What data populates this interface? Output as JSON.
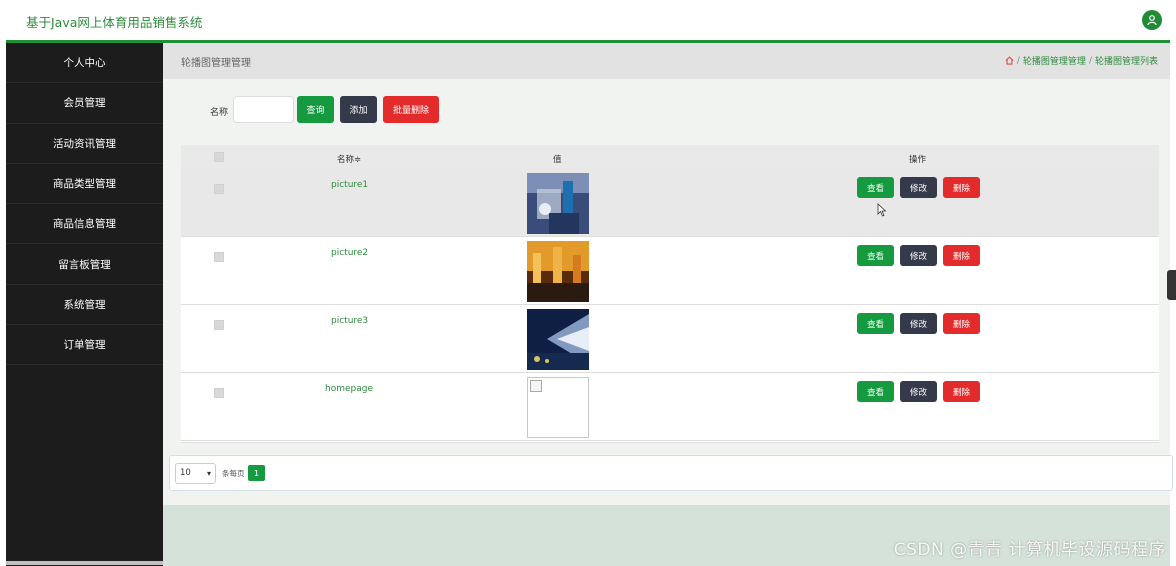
{
  "header": {
    "title": "基于Java网上体育用品销售系统",
    "avatar_icon": "user-icon"
  },
  "sidebar": {
    "items": [
      {
        "label": "个人中心"
      },
      {
        "label": "会员管理"
      },
      {
        "label": "活动资讯管理"
      },
      {
        "label": "商品类型管理"
      },
      {
        "label": "商品信息管理"
      },
      {
        "label": "留言板管理"
      },
      {
        "label": "系统管理"
      },
      {
        "label": "订单管理"
      }
    ]
  },
  "page": {
    "title": "轮播图管理管理",
    "breadcrumb": {
      "icon": "home-icon",
      "sep1": "/",
      "level1": "轮播图管理管理",
      "sep2": "/",
      "level2": "轮播图管理列表"
    }
  },
  "search": {
    "name_label": "名称",
    "name_value": "",
    "query_label": "查询",
    "add_label": "添加",
    "batch_delete_label": "批量删除"
  },
  "table": {
    "columns": {
      "name": "名称≑",
      "value": "值",
      "actions": "操作"
    },
    "rows": [
      {
        "name": "picture1",
        "image": "photo-blue-sports",
        "highlighted": true
      },
      {
        "name": "picture2",
        "image": "photo-orange-crowd",
        "highlighted": false
      },
      {
        "name": "picture3",
        "image": "photo-blue-arena",
        "highlighted": false
      },
      {
        "name": "homepage",
        "image": "broken-image",
        "highlighted": false
      }
    ],
    "actions": {
      "view": "查看",
      "edit": "修改",
      "delete": "删除"
    }
  },
  "pagination": {
    "page_size": "10",
    "per_page_label": "条每页",
    "current_page": "1"
  },
  "watermark": "CSDN @青青 计算机毕设源码程序",
  "colors": {
    "accent": "#1e9136",
    "sidebar_bg": "#1c1c1c",
    "danger": "#e42b2b",
    "dark": "#343a4a"
  }
}
